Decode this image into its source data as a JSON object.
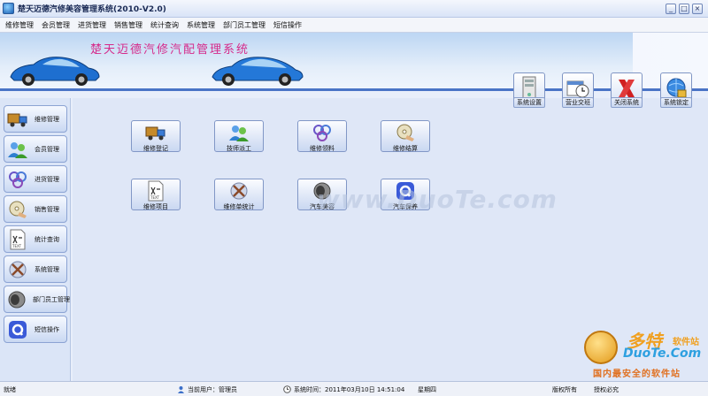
{
  "window": {
    "title": "楚天迈德汽修美容管理系统(2010-V2.0)",
    "buttons": [
      "_",
      "□",
      "×"
    ]
  },
  "menu": [
    "维修管理",
    "会员管理",
    "进货管理",
    "销售管理",
    "统计查询",
    "系统管理",
    "部门员工管理",
    "短信操作"
  ],
  "banner": {
    "title": "楚天迈德汽修汽配管理系统"
  },
  "toolbar": [
    {
      "label": "系统设置",
      "icon": "server-icon"
    },
    {
      "label": "营业交班",
      "icon": "clock-calendar-icon"
    },
    {
      "label": "关闭系统",
      "icon": "red-x-icon"
    },
    {
      "label": "系统锁定",
      "icon": "globe-lock-icon"
    }
  ],
  "sidebar": [
    {
      "label": "维修管理",
      "icon": "truck-icon"
    },
    {
      "label": "会员管理",
      "icon": "people-icon"
    },
    {
      "label": "进货管理",
      "icon": "molecule-icon"
    },
    {
      "label": "销售管理",
      "icon": "cd-hand-icon"
    },
    {
      "label": "统计查询",
      "icon": "text-document-icon"
    },
    {
      "label": "系统管理",
      "icon": "tools-icon"
    },
    {
      "label": "部门员工管理",
      "icon": "speaker-icon"
    },
    {
      "label": "短信操作",
      "icon": "message-icon"
    }
  ],
  "grid": [
    {
      "label": "维修登记",
      "icon": "truck-icon"
    },
    {
      "label": "技师派工",
      "icon": "people-icon"
    },
    {
      "label": "维修领料",
      "icon": "molecule-icon"
    },
    {
      "label": "维修结算",
      "icon": "cd-hand-icon"
    },
    {
      "label": "维修项目",
      "icon": "text-document-icon"
    },
    {
      "label": "维修单统计",
      "icon": "tools-icon"
    },
    {
      "label": "汽车美容",
      "icon": "speaker-icon"
    },
    {
      "label": "汽车保养",
      "icon": "message-icon"
    }
  ],
  "watermark": "www.DuoTe.com",
  "corner_logo": {
    "name": "多特",
    "suffix": "软件站",
    "url": "DuoTe.Com",
    "slogan": "国内最安全的软件站"
  },
  "status": {
    "ready": "就绪",
    "current_user": "当前用户：管理员",
    "system_time": "系统时间：2011年03月10日 14:51:04",
    "weekday": "星期四",
    "copyright": "版权所有",
    "authorized": "授权必究"
  },
  "colors": {
    "accent": "#4a74c6",
    "banner_title": "#d62a8a",
    "background": "#dfe7f7"
  }
}
